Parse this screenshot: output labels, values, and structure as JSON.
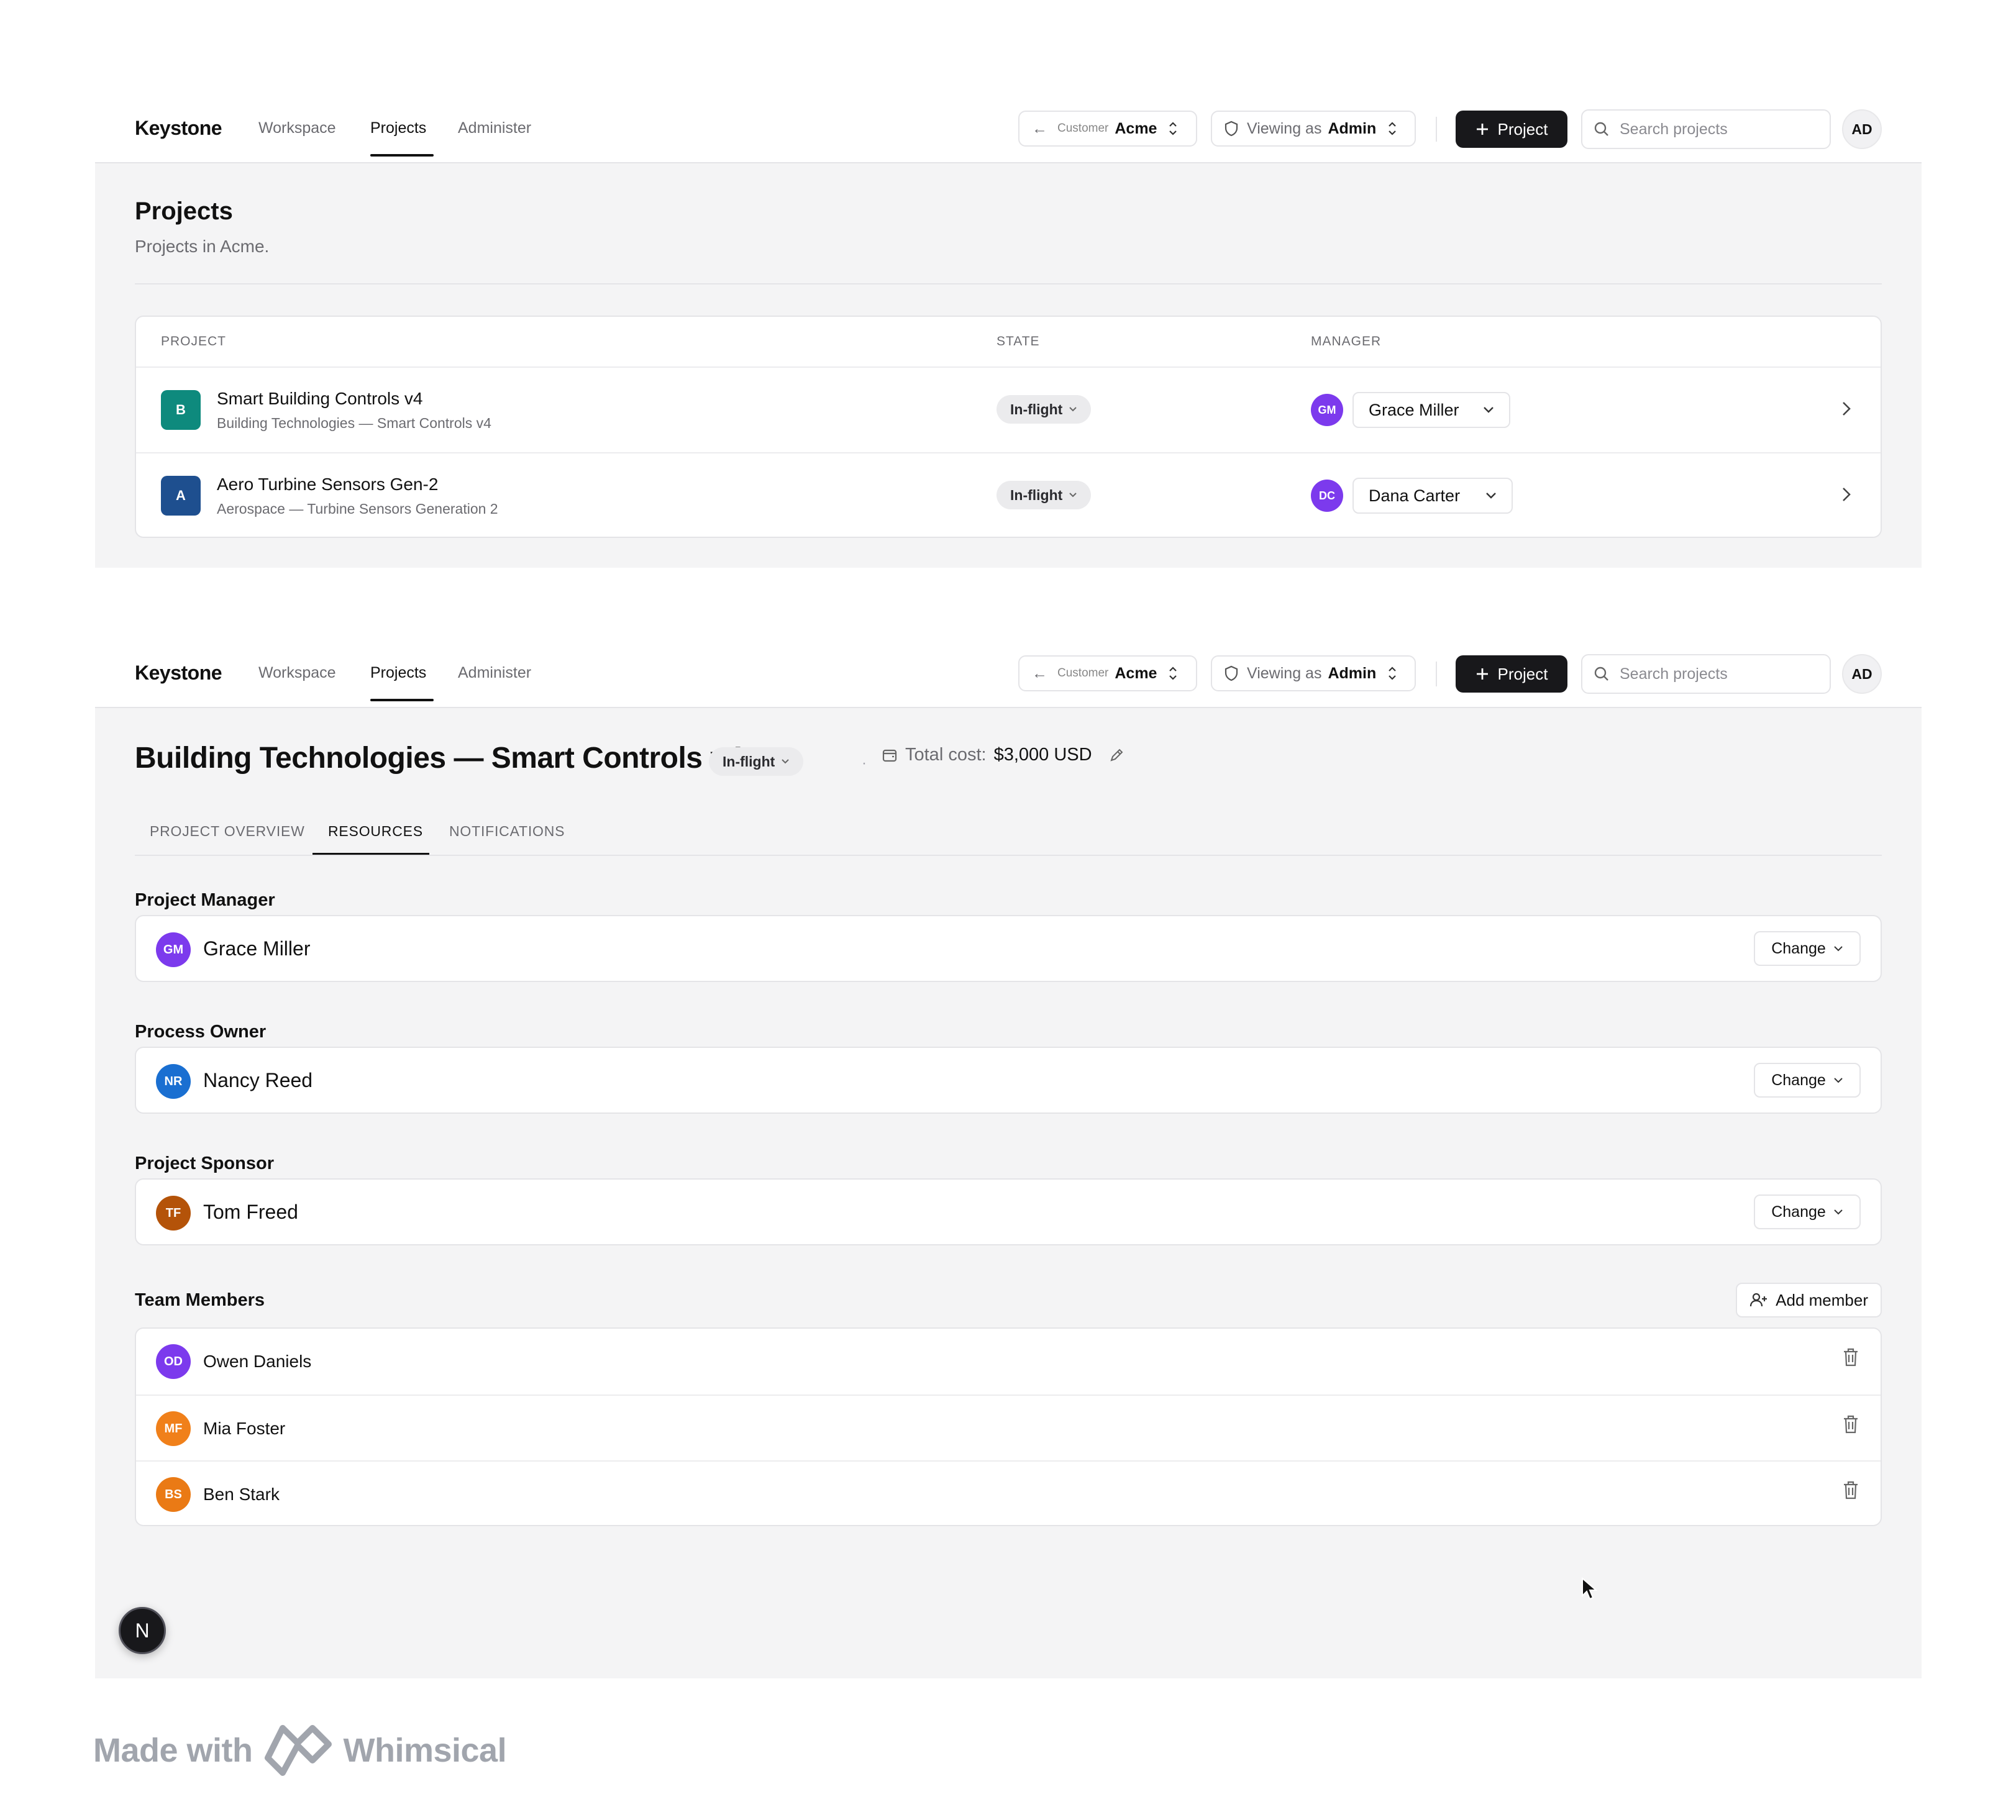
{
  "header": {
    "brand": "Keystone",
    "nav": [
      "Workspace",
      "Projects",
      "Administer"
    ],
    "active_nav": "Projects",
    "customer_label": "Customer",
    "customer_value": "Acme",
    "viewing_label": "Viewing as",
    "viewing_value": "Admin",
    "new_project_label": "Project",
    "search_placeholder": "Search projects",
    "user_initials": "AD"
  },
  "projects_page": {
    "title": "Projects",
    "subtitle": "Projects in Acme.",
    "columns": [
      "PROJECT",
      "STATE",
      "MANAGER"
    ],
    "rows": [
      {
        "initial": "B",
        "initial_color": "#0e8a7d",
        "name": "Smart Building Controls v4",
        "subtitle": "Building Technologies — Smart Controls v4",
        "state": "In-flight",
        "manager_initials": "GM",
        "manager_color": "#7c3aed",
        "manager": "Grace Miller"
      },
      {
        "initial": "A",
        "initial_color": "#1e4f8f",
        "name": "Aero Turbine Sensors Gen-2",
        "subtitle": "Aerospace — Turbine Sensors Generation 2",
        "state": "In-flight",
        "manager_initials": "DC",
        "manager_color": "#7c3aed",
        "manager": "Dana Carter"
      }
    ]
  },
  "project_detail": {
    "title": "Building Technologies — Smart Controls v4",
    "state": "In-flight",
    "cost_label": "Total cost:",
    "cost_value": "$3,000 USD",
    "tabs": [
      "PROJECT OVERVIEW",
      "RESOURCES",
      "NOTIFICATIONS"
    ],
    "active_tab": "RESOURCES",
    "change_label": "Change",
    "roles": [
      {
        "label": "Project Manager",
        "initials": "GM",
        "color": "#7c3aed",
        "name": "Grace Miller"
      },
      {
        "label": "Process Owner",
        "initials": "NR",
        "color": "#1a6fd1",
        "name": "Nancy Reed"
      },
      {
        "label": "Project Sponsor",
        "initials": "TF",
        "color": "#b45309",
        "name": "Tom Freed"
      }
    ],
    "team_label": "Team Members",
    "add_member_label": "Add member",
    "team": [
      {
        "initials": "OD",
        "color": "#7c3aed",
        "name": "Owen Daniels"
      },
      {
        "initials": "MF",
        "color": "#f0801a",
        "name": "Mia Foster"
      },
      {
        "initials": "BS",
        "color": "#ea7a15",
        "name": "Ben Stark"
      }
    ],
    "fab_letter": "N"
  },
  "footer": {
    "made_with": "Made with",
    "brand": "Whimsical"
  }
}
